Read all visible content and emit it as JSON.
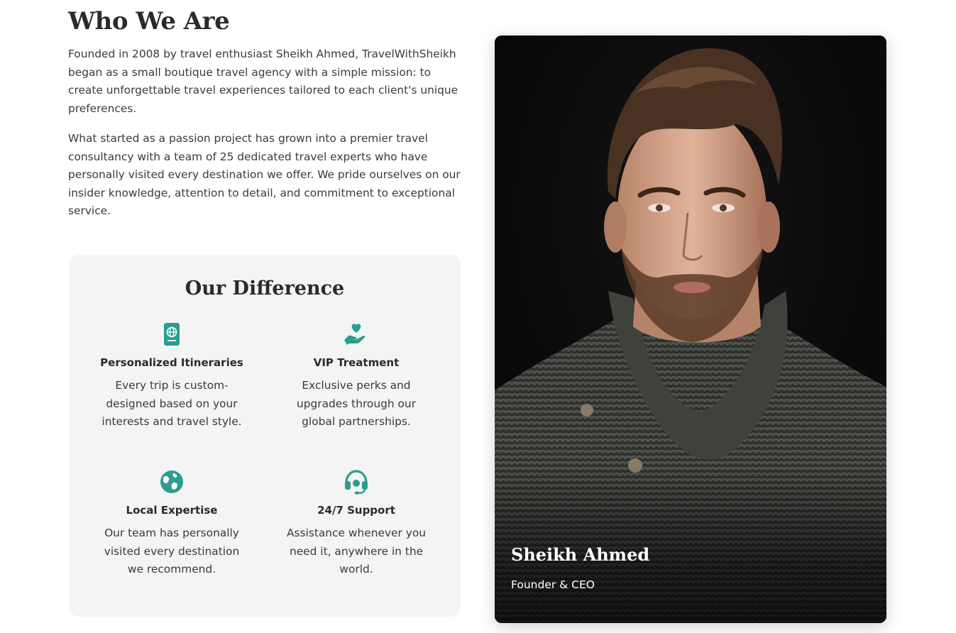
{
  "about": {
    "title": "Who We Are",
    "paragraphs": [
      "Founded in 2008 by travel enthusiast Sheikh Ahmed, TravelWithSheikh began as a small boutique travel agency with a simple mission: to create unforgettable travel experiences tailored to each client's unique preferences.",
      "What started as a passion project has grown into a premier travel consultancy with a team of 25 dedicated travel experts who have personally visited every destination we offer. We pride ourselves on our insider knowledge, attention to detail, and commitment to exceptional service."
    ]
  },
  "difference": {
    "title": "Our Difference",
    "features": [
      {
        "icon": "passport-icon",
        "title": "Personalized Itineraries",
        "description": "Every trip is custom-designed based on your interests and travel style."
      },
      {
        "icon": "hand-heart-icon",
        "title": "VIP Treatment",
        "description": "Exclusive perks and upgrades through our global partnerships."
      },
      {
        "icon": "globe-icon",
        "title": "Local Expertise",
        "description": "Our team has personally visited every destination we recommend."
      },
      {
        "icon": "headset-icon",
        "title": "24/7 Support",
        "description": "Assistance whenever you need it, anywhere in the world."
      }
    ]
  },
  "founder": {
    "name": "Sheikh Ahmed",
    "role": "Founder & CEO"
  },
  "colors": {
    "accent": "#2a9d8f",
    "heading": "#2b2b2b",
    "card_bg": "#f4f4f4"
  }
}
